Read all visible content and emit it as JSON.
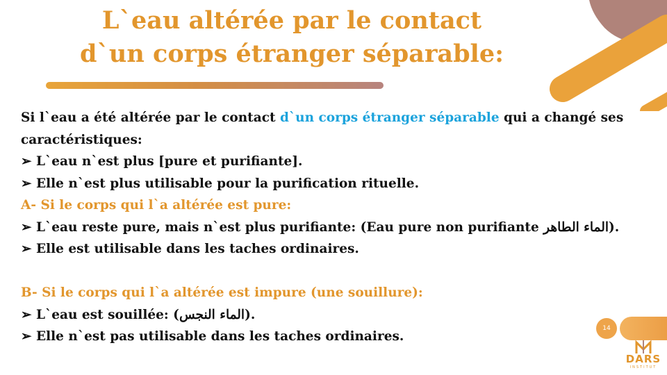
{
  "title": {
    "line1": "L`eau altérée par le contact",
    "line2": "d`un corps étranger séparable:"
  },
  "body": {
    "intro_a": "Si l`eau a été altérée par le contact ",
    "intro_highlight": "d`un corps étranger séparable",
    "intro_b": " qui a changé ses",
    "intro_c": "caractéristiques:",
    "bullets_1": [
      "L`eau n`est plus [pure et purifiante].",
      "Elle n`est plus utilisable pour la purification rituelle."
    ],
    "case_a": "A- Si le corps qui l`a altérée est pure:",
    "bullets_a": [
      "L`eau reste pure, mais n`est plus purifiante: (Eau pure non purifiante الماء الطاهر).",
      "Elle est utilisable dans les taches ordinaires."
    ],
    "case_b": "B- Si le corps qui l`a altérée est impure (une souillure):",
    "bullets_b": [
      "L`eau est souillée: (الماء النجس).",
      "Elle n`est pas utilisable dans les taches ordinaires."
    ],
    "bullet_glyph": "➢"
  },
  "footer": {
    "page_number": "14",
    "logo_text": "DARS",
    "logo_subtext": "INSTITUT"
  },
  "colors": {
    "orange": "#e2962d",
    "blue": "#1ca3dc",
    "mauve": "#b07f75"
  }
}
